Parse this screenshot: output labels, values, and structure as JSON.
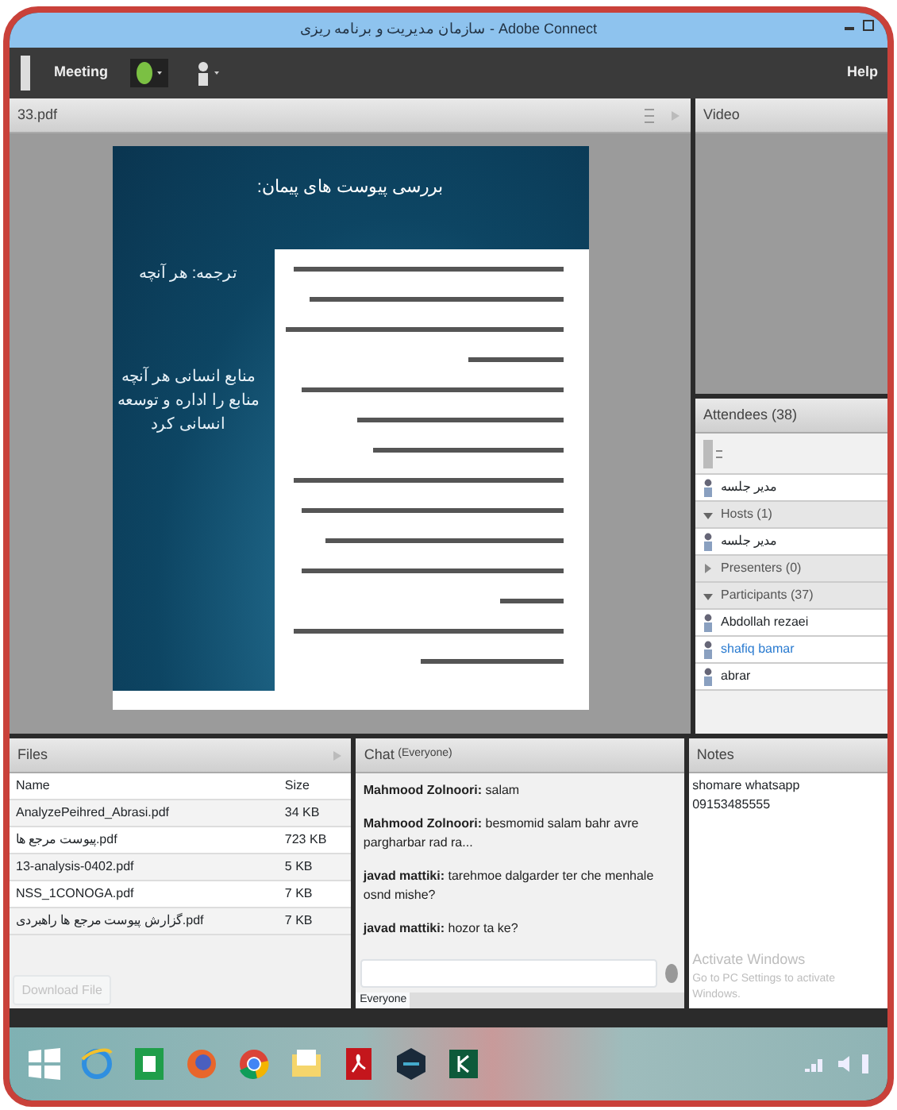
{
  "window": {
    "title": "سازمان مدیریت و برنامه ریزی - Adobe Connect"
  },
  "toolbar": {
    "menus": [
      "Meeting"
    ],
    "help": "Help"
  },
  "share_pod": {
    "title": "33.pdf",
    "slide": {
      "title": "بررسی پیوست های پیمان:",
      "left_caption": "ترجمه: هر آنچه",
      "left_text": "منابع انسانی هر آنچه منابع را اداره و توسعه انسانی کرد"
    }
  },
  "video_pod": {
    "title": "Video"
  },
  "attendees_pod": {
    "title": "Attendees (38)",
    "items": [
      {
        "kind": "user",
        "label": "مدیر جلسه",
        "selected": false
      },
      {
        "kind": "group",
        "label": "Hosts (1)",
        "expanded": true
      },
      {
        "kind": "user",
        "label": "مدیر جلسه",
        "selected": false
      },
      {
        "kind": "group",
        "label": "Presenters (0)",
        "expanded": false
      },
      {
        "kind": "group",
        "label": "Participants (37)",
        "expanded": true
      },
      {
        "kind": "user",
        "label": "Abdollah rezaei",
        "selected": false
      },
      {
        "kind": "user",
        "label": "shafiq bamar",
        "selected": true
      },
      {
        "kind": "user",
        "label": "abrar",
        "selected": false
      }
    ]
  },
  "files_pod": {
    "title": "Files",
    "columns": [
      "Name",
      "Size"
    ],
    "rows": [
      [
        "AnalyzePeihred_Abrasi.pdf",
        "34 KB"
      ],
      [
        "پیوست مرجع ها.pdf",
        "723 KB"
      ],
      [
        "13-analysis-0402.pdf",
        "5 KB"
      ],
      [
        "NSS_1CONOGA.pdf",
        "7 KB"
      ],
      [
        "گزارش پیوست مرجع ها راهبردی.pdf",
        "7 KB"
      ]
    ],
    "button": "Download File"
  },
  "chat_pod": {
    "title": "Chat",
    "audience": "(Everyone)",
    "messages": [
      {
        "sender": "Mahmood Zolnoori:",
        "text": "salam"
      },
      {
        "sender": "Mahmood Zolnoori:",
        "text": "besmomid salam bahr avre pargharbar rad ra..."
      },
      {
        "sender": "javad mattiki:",
        "text": "tarehmoe dalgarder ter che menhale osnd mishe?"
      },
      {
        "sender": "javad mattiki:",
        "text": "hozor ta ke?"
      }
    ],
    "tab": "Everyone"
  },
  "notes_pod": {
    "title": "Notes",
    "lines": [
      "shomare whatsapp",
      "09153485555"
    ]
  },
  "activation_notice": {
    "title": "Activate Windows",
    "text": "Go to PC Settings to activate Windows."
  },
  "taskbar": {
    "apps": [
      {
        "kind": "start"
      },
      {
        "kind": "browser"
      },
      {
        "kind": "spreadsheet"
      },
      {
        "kind": "firefox"
      },
      {
        "kind": "chrome"
      },
      {
        "kind": "folder"
      },
      {
        "kind": "pdf"
      },
      {
        "kind": "hexagon"
      },
      {
        "kind": "sheet"
      }
    ]
  }
}
